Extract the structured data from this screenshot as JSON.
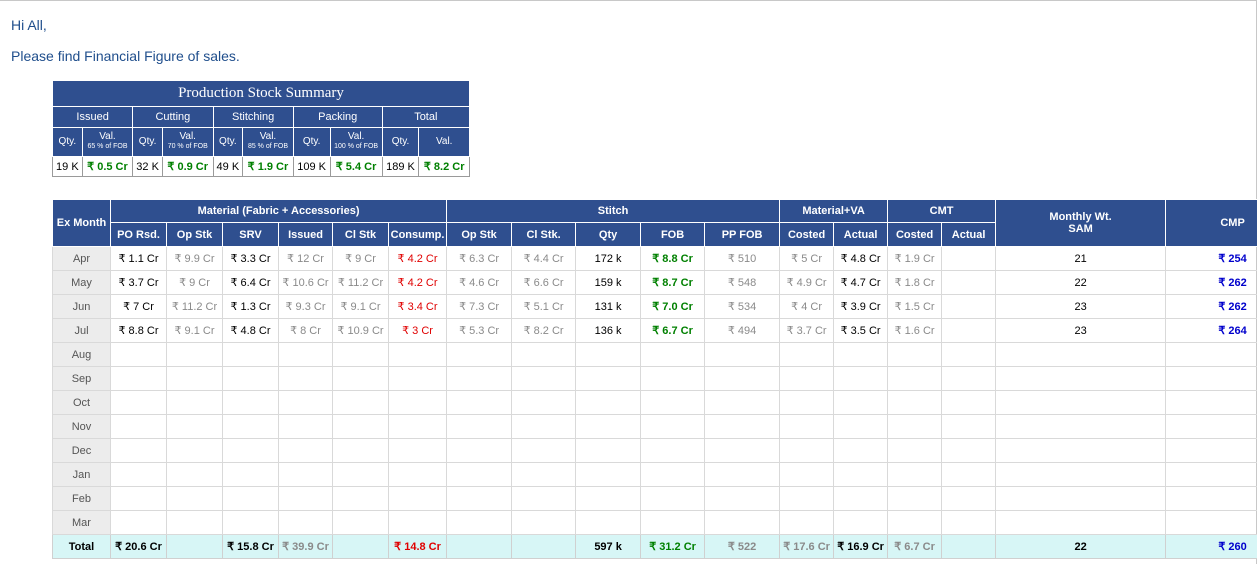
{
  "greeting": "Hi All,",
  "intro": "Please find Financial Figure of sales.",
  "summary": {
    "title": "Production Stock Summary",
    "groups": [
      "Issued",
      "Cutting",
      "Stitching",
      "Packing",
      "Total"
    ],
    "qty_label": "Qty.",
    "val_label": "Val.",
    "val_notes": [
      "65 % of FOB",
      "70 % of FOB",
      "85 % of FOB",
      "100 % of FOB"
    ],
    "values": [
      {
        "qty": "19 K",
        "val": "₹ 0.5 Cr"
      },
      {
        "qty": "32 K",
        "val": "₹ 0.9 Cr"
      },
      {
        "qty": "49 K",
        "val": "₹ 1.9 Cr"
      },
      {
        "qty": "109 K",
        "val": "₹ 5.4 Cr"
      },
      {
        "qty": "189 K",
        "val": "₹ 8.2 Cr"
      }
    ]
  },
  "main": {
    "headers": {
      "ex_month": "Ex Month",
      "material": "Material (Fabric + Accessories)",
      "stitch": "Stitch",
      "material_va": "Material+VA",
      "cmt": "CMT",
      "monthly_sam": "Monthly Wt. SAM",
      "cmp": "CMP",
      "sub": [
        "PO Rsd.",
        "Op Stk",
        "SRV",
        "Issued",
        "Cl Stk",
        "Consump.",
        "Op Stk",
        "Cl Stk.",
        "Qty",
        "FOB",
        "PP FOB",
        "Costed",
        "Actual",
        "Costed",
        "Actual"
      ]
    },
    "rows": [
      {
        "month": "Apr",
        "cells": [
          "₹ 1.1 Cr",
          "₹ 9.9 Cr",
          "₹ 3.3 Cr",
          "₹ 12 Cr",
          "₹ 9 Cr",
          "₹ 4.2 Cr",
          "₹ 6.3 Cr",
          "₹ 4.4 Cr",
          "172 k",
          "₹ 8.8 Cr",
          "₹ 510",
          "₹ 5 Cr",
          "₹ 4.8 Cr",
          "₹ 1.9 Cr",
          "",
          "21",
          "₹ 254"
        ]
      },
      {
        "month": "May",
        "cells": [
          "₹ 3.7 Cr",
          "₹ 9 Cr",
          "₹ 6.4 Cr",
          "₹ 10.6 Cr",
          "₹ 11.2 Cr",
          "₹ 4.2 Cr",
          "₹ 4.6 Cr",
          "₹ 6.6 Cr",
          "159 k",
          "₹ 8.7 Cr",
          "₹ 548",
          "₹ 4.9 Cr",
          "₹ 4.7 Cr",
          "₹ 1.8 Cr",
          "",
          "22",
          "₹ 262"
        ]
      },
      {
        "month": "Jun",
        "cells": [
          "₹ 7 Cr",
          "₹ 11.2 Cr",
          "₹ 1.3 Cr",
          "₹ 9.3 Cr",
          "₹ 9.1 Cr",
          "₹ 3.4 Cr",
          "₹ 7.3 Cr",
          "₹ 5.1 Cr",
          "131 k",
          "₹ 7.0 Cr",
          "₹ 534",
          "₹ 4 Cr",
          "₹ 3.9 Cr",
          "₹ 1.5 Cr",
          "",
          "23",
          "₹ 262"
        ]
      },
      {
        "month": "Jul",
        "cells": [
          "₹ 8.8 Cr",
          "₹ 9.1 Cr",
          "₹ 4.8 Cr",
          "₹ 8 Cr",
          "₹ 10.9 Cr",
          "₹ 3 Cr",
          "₹ 5.3 Cr",
          "₹ 8.2 Cr",
          "136 k",
          "₹ 6.7 Cr",
          "₹ 494",
          "₹ 3.7 Cr",
          "₹ 3.5 Cr",
          "₹ 1.6 Cr",
          "",
          "23",
          "₹ 264"
        ]
      },
      {
        "month": "Aug",
        "cells": [
          "",
          "",
          "",
          "",
          "",
          "",
          "",
          "",
          "",
          "",
          "",
          "",
          "",
          "",
          "",
          "",
          ""
        ]
      },
      {
        "month": "Sep",
        "cells": [
          "",
          "",
          "",
          "",
          "",
          "",
          "",
          "",
          "",
          "",
          "",
          "",
          "",
          "",
          "",
          "",
          ""
        ]
      },
      {
        "month": "Oct",
        "cells": [
          "",
          "",
          "",
          "",
          "",
          "",
          "",
          "",
          "",
          "",
          "",
          "",
          "",
          "",
          "",
          "",
          ""
        ]
      },
      {
        "month": "Nov",
        "cells": [
          "",
          "",
          "",
          "",
          "",
          "",
          "",
          "",
          "",
          "",
          "",
          "",
          "",
          "",
          "",
          "",
          ""
        ]
      },
      {
        "month": "Dec",
        "cells": [
          "",
          "",
          "",
          "",
          "",
          "",
          "",
          "",
          "",
          "",
          "",
          "",
          "",
          "",
          "",
          "",
          ""
        ]
      },
      {
        "month": "Jan",
        "cells": [
          "",
          "",
          "",
          "",
          "",
          "",
          "",
          "",
          "",
          "",
          "",
          "",
          "",
          "",
          "",
          "",
          ""
        ]
      },
      {
        "month": "Feb",
        "cells": [
          "",
          "",
          "",
          "",
          "",
          "",
          "",
          "",
          "",
          "",
          "",
          "",
          "",
          "",
          "",
          "",
          ""
        ]
      },
      {
        "month": "Mar",
        "cells": [
          "",
          "",
          "",
          "",
          "",
          "",
          "",
          "",
          "",
          "",
          "",
          "",
          "",
          "",
          "",
          "",
          ""
        ]
      }
    ],
    "total": {
      "label": "Total",
      "cells": [
        "₹ 20.6 Cr",
        "",
        "₹ 15.8 Cr",
        "₹ 39.9 Cr",
        "",
        "₹ 14.8 Cr",
        "",
        "",
        "597 k",
        "₹ 31.2 Cr",
        "₹ 522",
        "₹ 17.6 Cr",
        "₹ 16.9 Cr",
        "₹ 6.7 Cr",
        "",
        "22",
        "₹ 260"
      ]
    },
    "colors": {
      "header_bg": "#2f4f8f",
      "total_bg": "#d7f6f6",
      "consumption": "#e00000",
      "fob": "#008000",
      "cmp": "#0000cc",
      "muted": "#8a8a8a"
    }
  }
}
